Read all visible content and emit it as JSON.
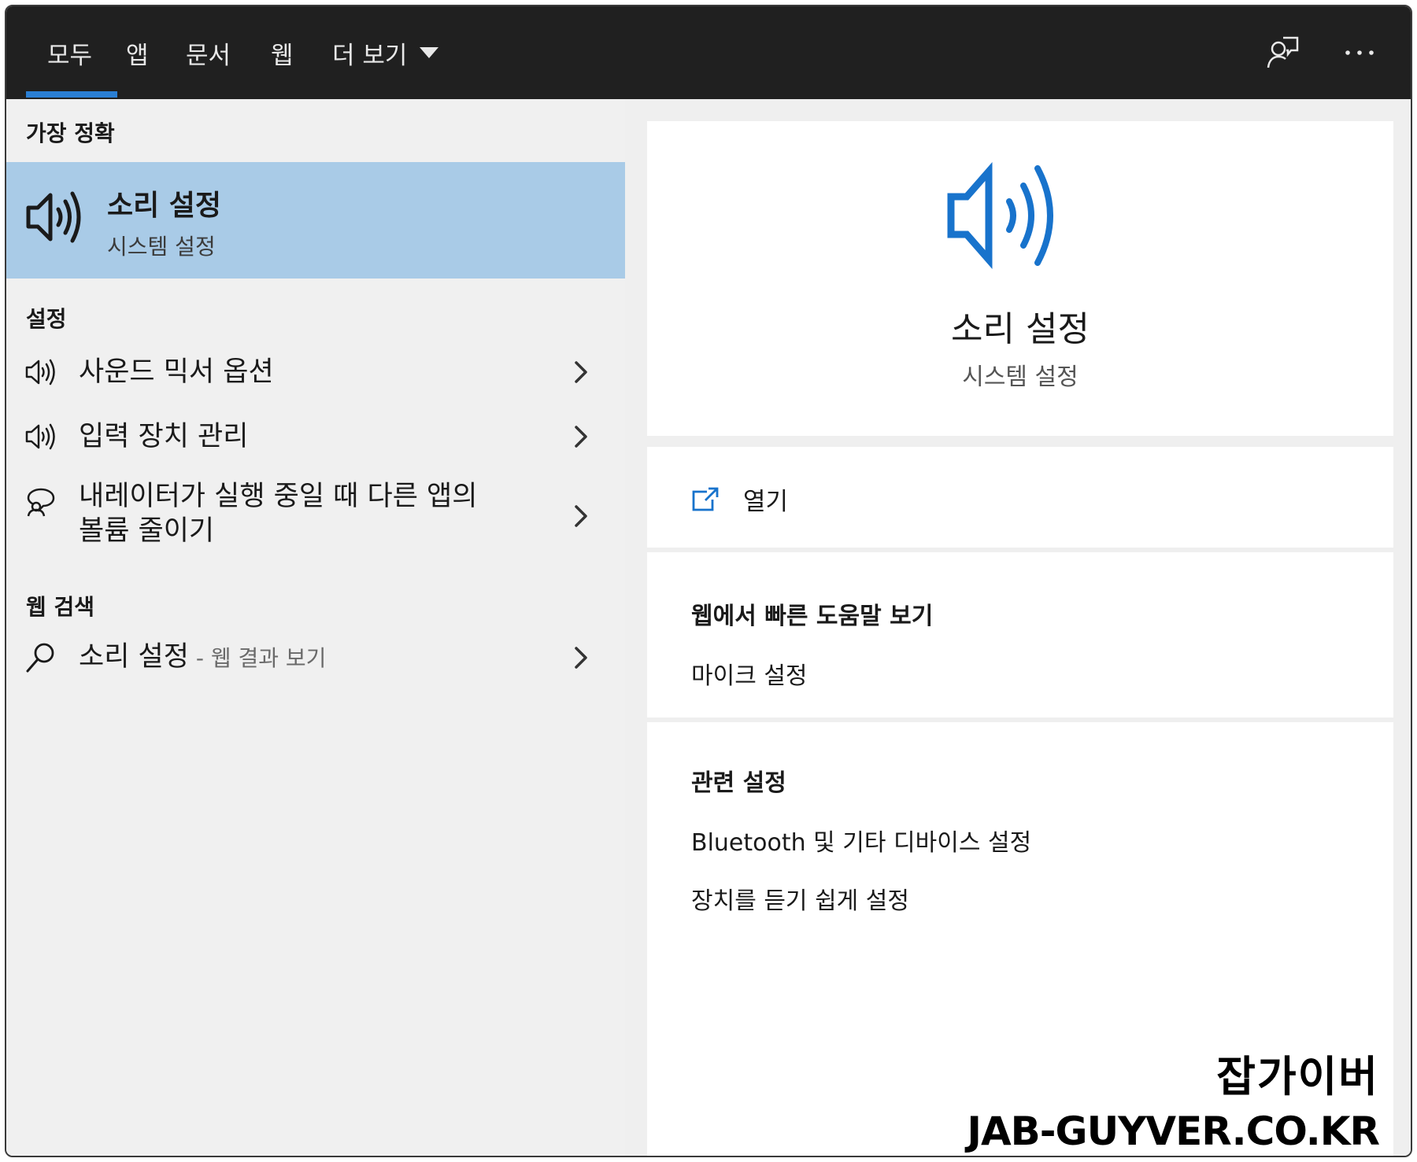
{
  "tabs": [
    {
      "label": "모두",
      "active": true
    },
    {
      "label": "앱"
    },
    {
      "label": "문서"
    },
    {
      "label": "웹"
    },
    {
      "label": "더 보기"
    }
  ],
  "top_icons": [
    "feedback-person-icon",
    "more-ellipsis-icon"
  ],
  "accent": "#2a7fd4",
  "left": {
    "best_match_heading": "가장 정확",
    "best_match": {
      "title": "소리 설정",
      "subtitle": "시스템 설정",
      "icon": "speaker-icon"
    },
    "settings_heading": "설정",
    "settings_items": [
      {
        "label": "사운드 믹서 옵션",
        "icon": "speaker-icon"
      },
      {
        "label": "입력 장치 관리",
        "icon": "speaker-icon"
      },
      {
        "label_line1": "내레이터가 실행 중일 때 다른 앱의",
        "label_line2": "볼륨 줄이기",
        "icon": "narrator-icon"
      }
    ],
    "web_heading": "웹 검색",
    "web_item": {
      "label": "소리 설정",
      "hint": " - 웹 결과 보기",
      "icon": "search-icon"
    }
  },
  "right": {
    "hero": {
      "title": "소리 설정",
      "subtitle": "시스템 설정",
      "icon": "speaker-icon"
    },
    "open_label": "열기",
    "quick_help_heading": "웹에서 빠른 도움말 보기",
    "quick_help_links": [
      "마이크 설정"
    ],
    "related_heading": "관련 설정",
    "related_links": [
      "Bluetooth 및 기타 디바이스 설정",
      "장치를 듣기 쉽게 설정"
    ]
  },
  "watermark": {
    "line1": "잡가이버",
    "line2": "JAB-GUYVER.CO.KR"
  }
}
